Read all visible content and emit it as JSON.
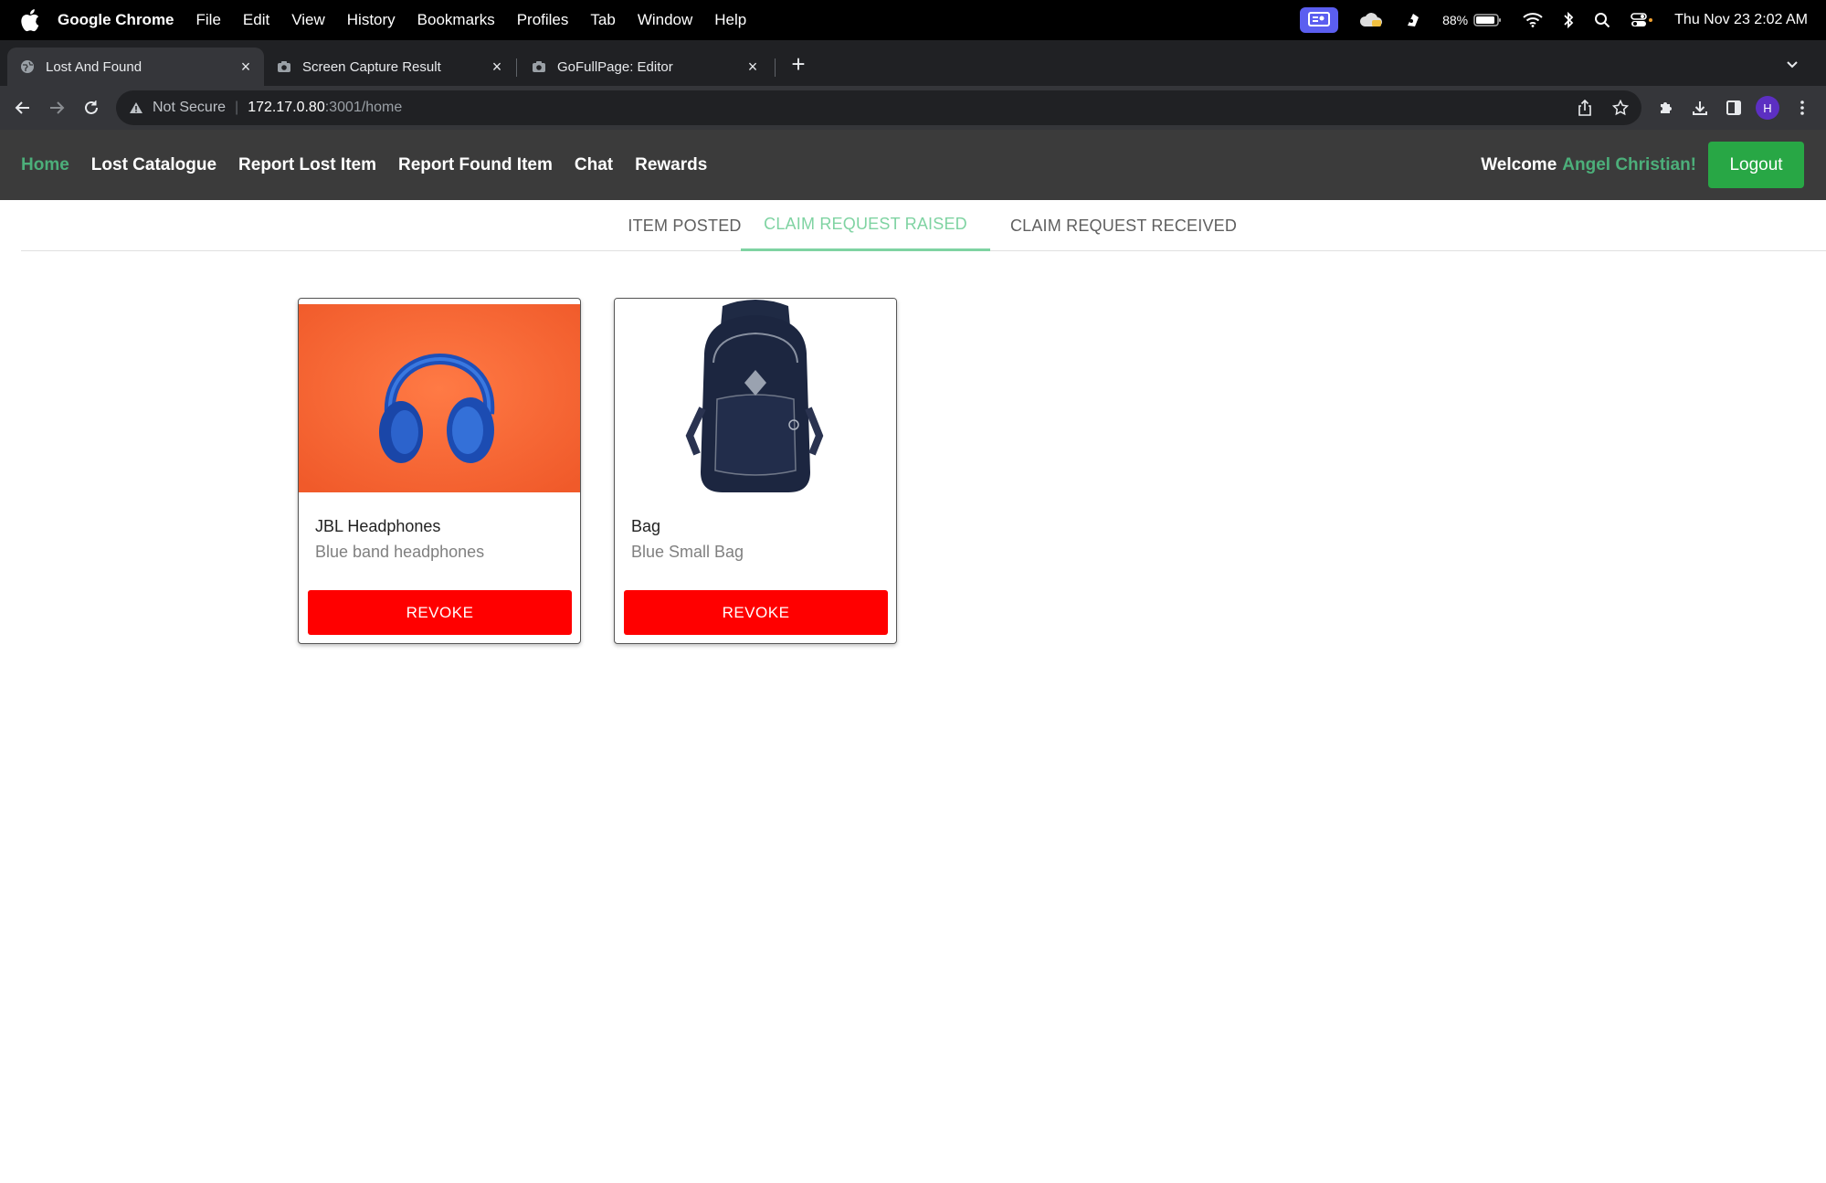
{
  "menubar": {
    "app_name": "Google Chrome",
    "items": [
      "File",
      "Edit",
      "View",
      "History",
      "Bookmarks",
      "Profiles",
      "Tab",
      "Window",
      "Help"
    ],
    "battery": "88%",
    "clock": "Thu Nov 23  2:02 AM"
  },
  "browser": {
    "tabs": [
      {
        "title": "Lost And Found",
        "active": true
      },
      {
        "title": "Screen Capture Result",
        "active": false
      },
      {
        "title": "GoFullPage: Editor",
        "active": false
      }
    ],
    "omnibox": {
      "security_label": "Not Secure",
      "host": "172.17.0.80",
      "path": ":3001/home"
    },
    "profile_initial": "H"
  },
  "nav": {
    "links": [
      "Home",
      "Lost Catalogue",
      "Report Lost Item",
      "Report Found Item",
      "Chat",
      "Rewards"
    ],
    "active": "Home",
    "welcome_label": "Welcome",
    "user_name": "Angel Christian!",
    "logout_label": "Logout"
  },
  "page_tabs": {
    "items": [
      "ITEM POSTED",
      "CLAIM REQUEST RAISED",
      "CLAIM REQUEST RECEIVED"
    ],
    "active": "CLAIM REQUEST RAISED"
  },
  "cards": [
    {
      "title": "JBL Headphones",
      "description": "Blue band headphones",
      "action": "REVOKE",
      "image": "headphones-photo"
    },
    {
      "title": "Bag",
      "description": "Blue Small Bag",
      "action": "REVOKE",
      "image": "backpack-photo"
    }
  ],
  "colors": {
    "accent_green": "#4caf7a",
    "logout_green": "#28a745",
    "revoke_red": "#ff0000",
    "nav_bg": "#3b3b3b"
  }
}
